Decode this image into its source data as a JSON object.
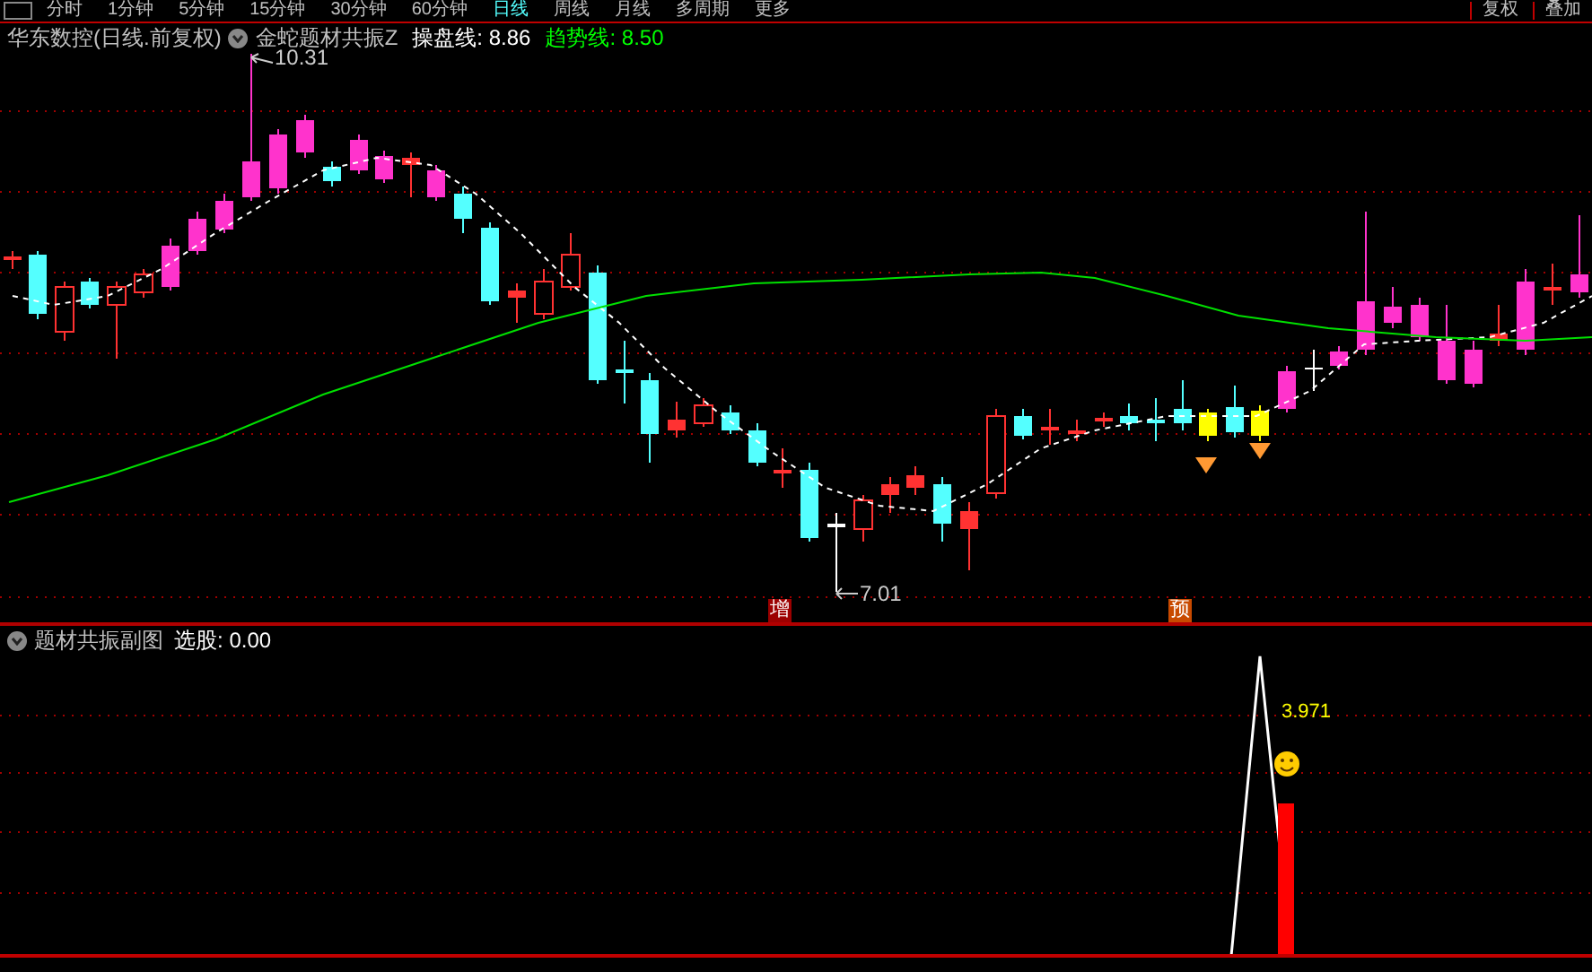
{
  "toolbar": {
    "periods": [
      {
        "label": "分时",
        "selected": false
      },
      {
        "label": "1分钟",
        "selected": false
      },
      {
        "label": "5分钟",
        "selected": false
      },
      {
        "label": "15分钟",
        "selected": false
      },
      {
        "label": "30分钟",
        "selected": false
      },
      {
        "label": "60分钟",
        "selected": false
      },
      {
        "label": "日线",
        "selected": true
      },
      {
        "label": "周线",
        "selected": false
      },
      {
        "label": "月线",
        "selected": false
      },
      {
        "label": "多周期",
        "selected": false
      },
      {
        "label": "更多",
        "selected": false
      }
    ],
    "buttons": [
      "复权",
      "叠加"
    ]
  },
  "main_chart": {
    "stock": "华东数控(日线.前复权)",
    "indicator": "金蛇题材共振Z",
    "lines": [
      {
        "label": "操盘线:",
        "value": "8.86",
        "color": "#ffffff"
      },
      {
        "label": "趋势线:",
        "value": "8.50",
        "color": "#00ff00"
      }
    ],
    "high_label": "10.31",
    "low_label": "7.01",
    "signals": [
      {
        "text": "增",
        "color": "#9c0000"
      },
      {
        "text": "预",
        "color": "#c84a00"
      }
    ]
  },
  "sub_chart": {
    "title": "题材共振副图",
    "pick_label": "选股:",
    "pick_value": "0.00",
    "value_label": "3.971"
  }
}
